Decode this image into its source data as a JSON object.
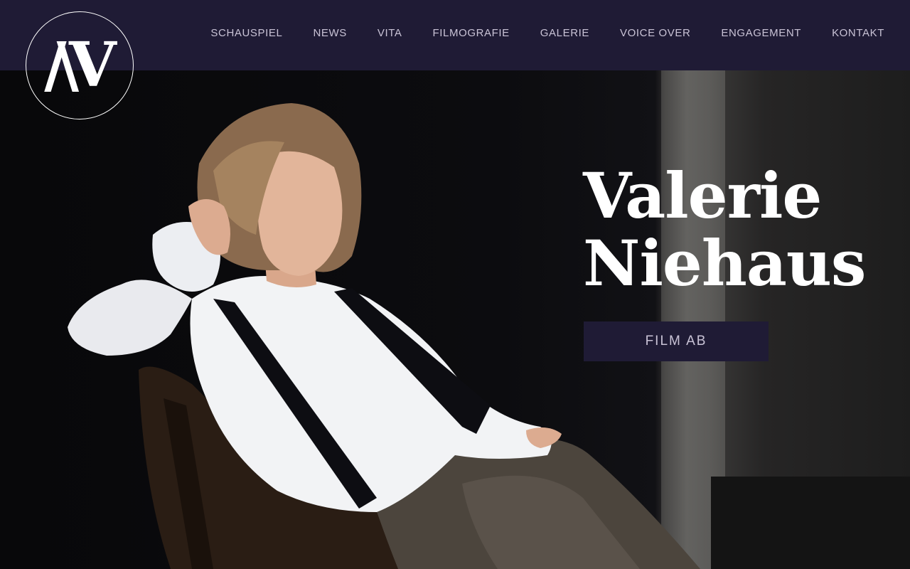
{
  "header": {
    "logo_alt": "VN monogram",
    "nav_items": [
      "SCHAUSPIEL",
      "NEWS",
      "VITA",
      "FILMOGRAFIE",
      "GALERIE",
      "VOICE OVER",
      "ENGAGEMENT",
      "KONTAKT"
    ]
  },
  "hero": {
    "first_name": "Valerie",
    "last_name": "Niehaus",
    "cta_label": "FILM AB",
    "photo_subject": "woman in white shirt with black suspenders seated on wooden chair"
  },
  "colors": {
    "navbar_bg": "#1f1b35",
    "nav_text": "#c9c3d6",
    "headline": "#ffffff",
    "cta_bg": "#1f1b35"
  }
}
